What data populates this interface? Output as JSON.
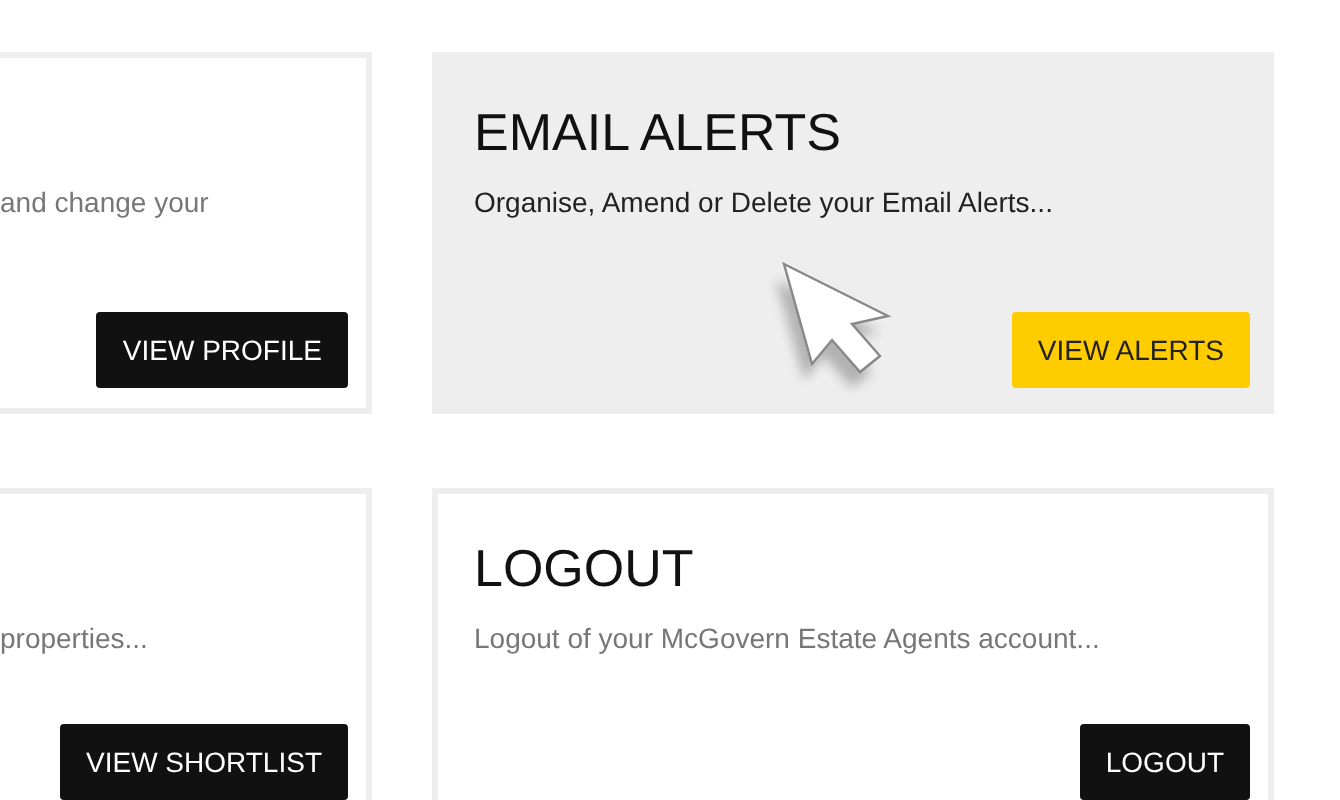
{
  "cards": [
    {
      "description": "and change your",
      "button": "VIEW PROFILE",
      "highlighted": false
    },
    {
      "title": "EMAIL ALERTS",
      "description": "Organise, Amend or Delete your Email Alerts...",
      "button": "VIEW ALERTS",
      "highlighted": true
    },
    {
      "description": "properties...",
      "button": "VIEW SHORTLIST",
      "highlighted": false
    },
    {
      "title": "LOGOUT",
      "description": "Logout of your McGovern Estate Agents account...",
      "button": "LOGOUT",
      "highlighted": false
    }
  ]
}
